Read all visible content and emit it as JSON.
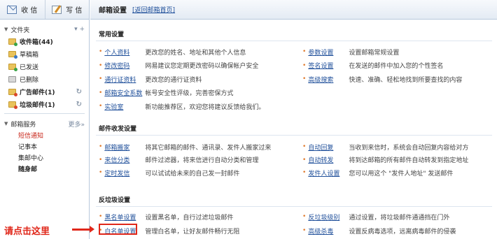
{
  "sidebar": {
    "actions": [
      {
        "label": "收 信",
        "icon": "inbox-icon"
      },
      {
        "label": "写 信",
        "icon": "compose-icon"
      }
    ],
    "folders_header": {
      "label": "文件夹",
      "right": "▾ +"
    },
    "folders": [
      {
        "label": "收件箱(44)",
        "bold": true,
        "icon": "green"
      },
      {
        "label": "草稿箱",
        "bold": false,
        "icon": "blue"
      },
      {
        "label": "已发送",
        "bold": false,
        "icon": "green"
      },
      {
        "label": "已删除",
        "bold": false,
        "icon": "grey"
      },
      {
        "label": "广告邮件(1)",
        "bold": true,
        "icon": "red",
        "arrow": "↻"
      },
      {
        "label": "垃圾邮件(1)",
        "bold": true,
        "icon": "red",
        "arrow": "↻"
      }
    ],
    "services_header": {
      "label": "邮箱服务",
      "more": "更多»"
    },
    "services": [
      {
        "label": "短信通知",
        "style": "red"
      },
      {
        "label": "记事本",
        "style": ""
      },
      {
        "label": "集邮中心",
        "style": ""
      },
      {
        "label": "随身邮",
        "style": "bold"
      }
    ]
  },
  "main": {
    "title": "邮箱设置",
    "back_link": "[返回邮箱首页]",
    "sections": [
      {
        "title": "常用设置",
        "left": [
          {
            "link": "个人资料",
            "desc": "更改您的姓名、地址和其他个人信息"
          },
          {
            "link": "修改密码",
            "desc": "网易建议您定期更改密码以确保帐户安全"
          },
          {
            "link": "通行证资料",
            "desc": "更改您的通行证资料"
          },
          {
            "link": "邮箱安全系数",
            "desc": "帐号安全性评级，完善密保方式"
          },
          {
            "link": "实验室",
            "desc": "新功能推荐区，欢迎您将建议反馈给我们。"
          }
        ],
        "right": [
          {
            "link": "参数设置",
            "desc": "设置邮箱常规设置"
          },
          {
            "link": "签名设置",
            "desc": "在发送的邮件中加入您的个性签名"
          },
          {
            "link": "高级搜索",
            "desc": "快速、准确、轻松地找到所要查找的内容"
          }
        ]
      },
      {
        "title": "邮件收发设置",
        "left": [
          {
            "link": "邮箱搬家",
            "desc": "将其它邮箱的邮件、通讯录、发件人搬家过来"
          },
          {
            "link": "来信分类",
            "desc": "邮件过滤器，将来信进行自动分类和管理"
          },
          {
            "link": "定时发信",
            "desc": "可以试试给未来的自己发一封邮件"
          }
        ],
        "right": [
          {
            "link": "自动回复",
            "desc": "当收到来信时，系统会自动回复内容给对方"
          },
          {
            "link": "自动转发",
            "desc": "将到达邮箱的所有邮件自动转发到指定地址"
          },
          {
            "link": "发件人设置",
            "desc": "您可以用这个 \"发件人地址\" 发送邮件"
          }
        ]
      },
      {
        "title": "反垃圾设置",
        "left": [
          {
            "link": "黑名单设置",
            "desc": "设置黑名单，自行过滤垃圾邮件"
          },
          {
            "link": "白名单设置",
            "desc": "管理白名单，让好友邮件畅行无阻"
          }
        ],
        "right": [
          {
            "link": "反垃圾级别",
            "desc": "通过设置，将垃圾邮件通通挡在门外"
          },
          {
            "link": "高级杀毒",
            "desc": "设置反病毒选项，远离病毒邮件的侵袭"
          }
        ]
      }
    ]
  },
  "callout": {
    "text": "请点击这里",
    "color": "#e0271a"
  }
}
